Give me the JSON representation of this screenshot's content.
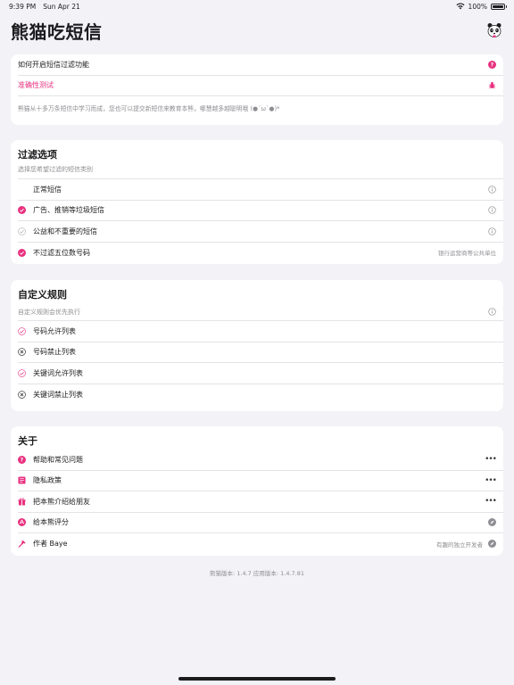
{
  "status": {
    "time": "9:39 PM",
    "date": "Sun Apr 21",
    "battery": "100%"
  },
  "header": {
    "title": "熊猫吃短信"
  },
  "intro": {
    "howto": "如何开启短信过滤功能",
    "accuracy": "准确性测试",
    "description": "熊猫从十多万条短信中学习而成，您也可以提交新短信来教育本熊，哪慧越多越聪明哦 (●´ω`●)*"
  },
  "filter": {
    "title": "过滤选项",
    "subtitle": "选择您希望过滤的短信类别",
    "items": [
      {
        "label": "正常短信",
        "checked": false,
        "style": "none"
      },
      {
        "label": "广告、推销等垃圾短信",
        "checked": true,
        "style": "filled"
      },
      {
        "label": "公益和不重要的短信",
        "checked": false,
        "style": "outline-gray"
      },
      {
        "label": "不过滤五位数号码",
        "checked": true,
        "style": "filled",
        "note": "银行运营商等公共单位"
      }
    ]
  },
  "rules": {
    "title": "自定义规则",
    "subtitle": "自定义规则会优先执行",
    "items": [
      {
        "label": "号码允许列表",
        "kind": "allow"
      },
      {
        "label": "号码禁止列表",
        "kind": "deny"
      },
      {
        "label": "关键词允许列表",
        "kind": "allow"
      },
      {
        "label": "关键词禁止列表",
        "kind": "deny"
      }
    ]
  },
  "about": {
    "title": "关于",
    "items": [
      {
        "label": "帮助和常见问题",
        "icon": "help-icon",
        "trail": "more"
      },
      {
        "label": "隐私政策",
        "icon": "document-icon",
        "trail": "more"
      },
      {
        "label": "把本熊介绍给朋友",
        "icon": "gift-icon",
        "trail": "more"
      },
      {
        "label": "给本熊评分",
        "icon": "app-store-icon",
        "trail": "external"
      },
      {
        "label": "作者 Baye",
        "icon": "hammer-icon",
        "trail": "external",
        "note": "有趣的独立开发者"
      }
    ]
  },
  "footer": {
    "version": "熊猫版本: 1.4.7 应用版本: 1.4.7.81"
  },
  "colors": {
    "accent": "#e8317f",
    "background": "#f2f2f7",
    "secondary": "#8e8e93"
  }
}
